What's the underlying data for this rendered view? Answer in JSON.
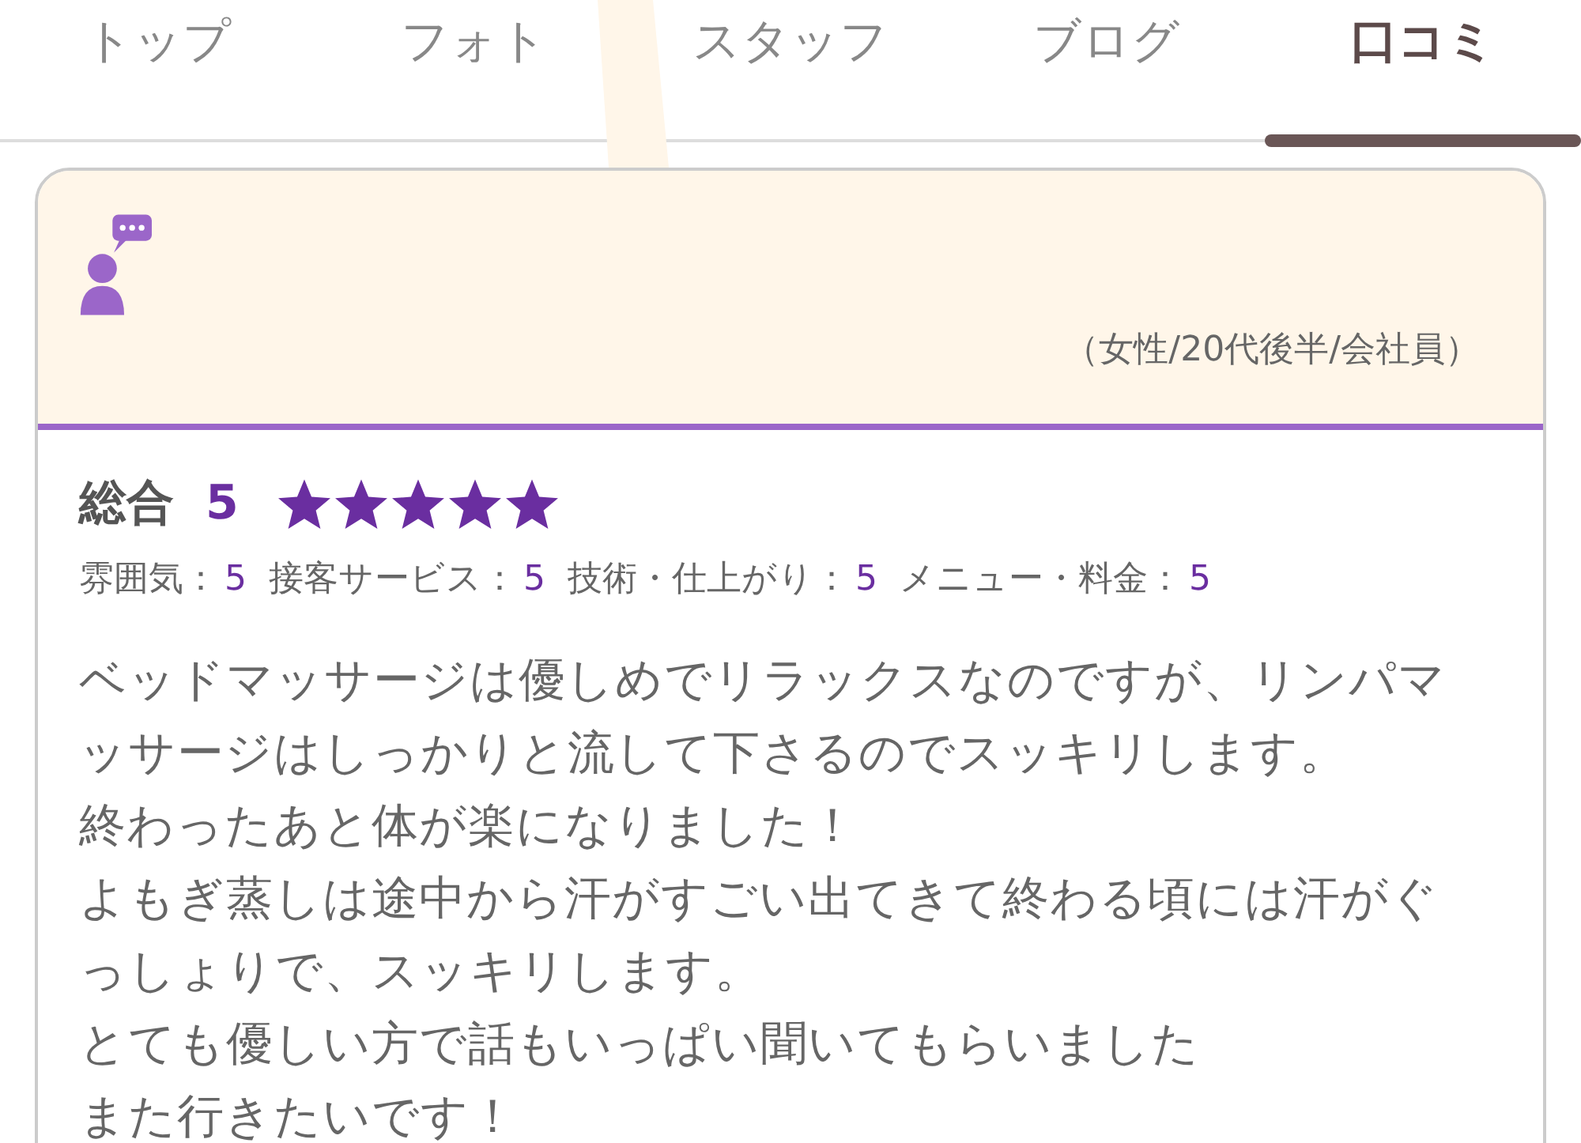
{
  "tabs": [
    {
      "label": "トップ",
      "selected": false
    },
    {
      "label": "フォト",
      "selected": false
    },
    {
      "label": "スタッフ",
      "selected": false
    },
    {
      "label": "ブログ",
      "selected": false
    },
    {
      "label": "口コミ",
      "selected": true
    }
  ],
  "review": {
    "reviewer": {
      "profile": "（女性/20代後半/会社員）"
    },
    "overall": {
      "label": "総合",
      "score": "5",
      "stars": 5
    },
    "ratings": [
      {
        "label": "雰囲気：",
        "score": "5"
      },
      {
        "label": "接客サービス：",
        "score": "5"
      },
      {
        "label": "技術・仕上がり：",
        "score": "5"
      },
      {
        "label": "メニュー・料金：",
        "score": "5"
      }
    ],
    "body": [
      "ベッドマッサージは優しめでリラックスなのですが、リンパマッサージはしっかりと流して下さるのでスッキリします。",
      "終わったあと体が楽になりました！",
      "よもぎ蒸しは途中から汗がすごい出てきて終わる頃には汗がぐっしょりで、スッキリします。",
      "とても優しい方で話もいっぱい聞いてもらいました",
      "また行きたいです！"
    ]
  }
}
